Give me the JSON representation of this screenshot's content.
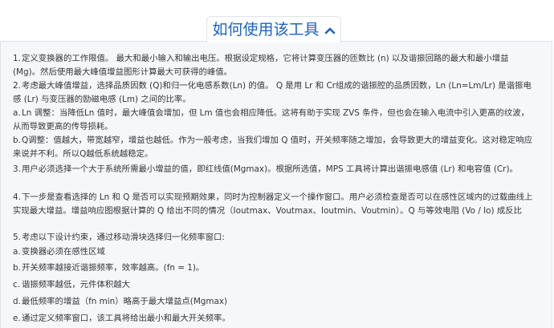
{
  "header": {
    "title": "如何使用该工具",
    "toggle_icon": "chevron-up-icon",
    "accent_color": "#1a63c6"
  },
  "items": [
    {
      "marker": "1.",
      "text": "定义变换器的工作限值。 最大和最小输入和输出电压。根据设定规格，它将计算变压器的匝数比 (n) 以及谐振回路的最大和最小增益 (Mg)。然后使用最大峰值增益图形计算最大可获得的峰值。"
    },
    {
      "marker": "2.",
      "text": "考虑最大峰值增益，选择品质因数 (Q)和归一化电感系数(Ln) 的值。 Q 是用 Lr 和 Cr组成的谐振腔的品质因数，Ln (Ln=Lm/Lr) 是谐振电感 (Lr) 与变压器的励磁电感 (Lm) 之间的比率。"
    },
    {
      "marker": "a.",
      "text": "Ln 调整：当降低Ln 值时，最大峰值会增加，但 Lm 值也会相应降低。这将有助于实现 ZVS 条件，但也会在输入电流中引入更高的纹波，从而导致更高的传导损耗。"
    },
    {
      "marker": "b.",
      "text": "Q调整：值越大，带宽越窄，增益也越低。作为一般考虑，当我们增加 Q 值时，开关频率随之增加，会导致更大的增益变化。这对稳定响应来说并不利。所以Q越低系统越稳定。"
    },
    {
      "marker": "3.",
      "text": "用户必须选择一个大于系统所需最小增益的值，即红线值(Mgmax)。根据所选值，MPS 工具将计算出谐振电感值 (Lr) 和电容值 (Cr)。"
    },
    {
      "marker": "4.",
      "text": "下一步是查看选择的 Ln 和 Q 是否可以实现预期效果，同时为控制器定义一个操作窗口。用户必须检查是否可以在感性区域内的过载曲线上实现最大增益。增益响应图根据计算的 Q 给出不同的情况（Ioutmax、Voutmax、Ioutmin、Voutmin）。Q 与等效电阻 (Vo / Io) 成反比"
    },
    {
      "marker": "5.",
      "text": "考虑以下设计约束，通过移动滑块选择归一化频率窗口:"
    },
    {
      "marker": "a.",
      "text": "变换器必须在感性区域"
    },
    {
      "marker": "b.",
      "text": "开关频率越接近谐振频率，效率越高。(fn = 1)。"
    },
    {
      "marker": "c.",
      "text": "谐振频率越低，元件体积越大"
    },
    {
      "marker": "d.",
      "text": "最低频率的增益（fn min）略高于最大增益点(Mgmax)"
    },
    {
      "marker": "e.",
      "text": "通过定义频率窗口，该工具将给出最小和最大开关频率。"
    }
  ]
}
